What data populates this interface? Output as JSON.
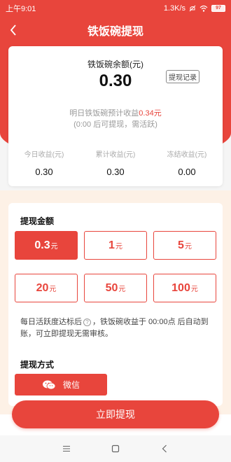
{
  "status_bar": {
    "time": "上午9:01",
    "speed": "1.3K/s",
    "battery": "97"
  },
  "header": {
    "title": "铁饭碗提现"
  },
  "balance": {
    "label": "铁饭碗余额(元)",
    "value": "0.30",
    "record_button": "提现记录",
    "forecast_prefix": "明日铁饭碗预计收益",
    "forecast_amount": "0.34元",
    "forecast_note": "(0:00 后可提现，需活跃)"
  },
  "stats": [
    {
      "label": "今日收益(元)",
      "value": "0.30"
    },
    {
      "label": "累计收益(元)",
      "value": "0.30"
    },
    {
      "label": "冻结收益(元)",
      "value": "0.00"
    }
  ],
  "amount_section": {
    "title": "提现金额",
    "options": [
      {
        "value": "0.3",
        "unit": "元",
        "selected": true
      },
      {
        "value": "1",
        "unit": "元",
        "selected": false
      },
      {
        "value": "5",
        "unit": "元",
        "selected": false
      },
      {
        "value": "20",
        "unit": "元",
        "selected": false
      },
      {
        "value": "50",
        "unit": "元",
        "selected": false
      },
      {
        "value": "100",
        "unit": "元",
        "selected": false
      }
    ],
    "rule_before": "每日活跃度达标后",
    "rule_after": "，铁饭碗收益于 00:00点 后自动到账，可立即提现无需审核。",
    "help_icon_glyph": "?"
  },
  "method_section": {
    "title": "提现方式",
    "wechat_label": "微信"
  },
  "withdraw_button": "立即提现",
  "colors": {
    "accent": "#e8453c",
    "warm_background": "#fdf1e6"
  }
}
